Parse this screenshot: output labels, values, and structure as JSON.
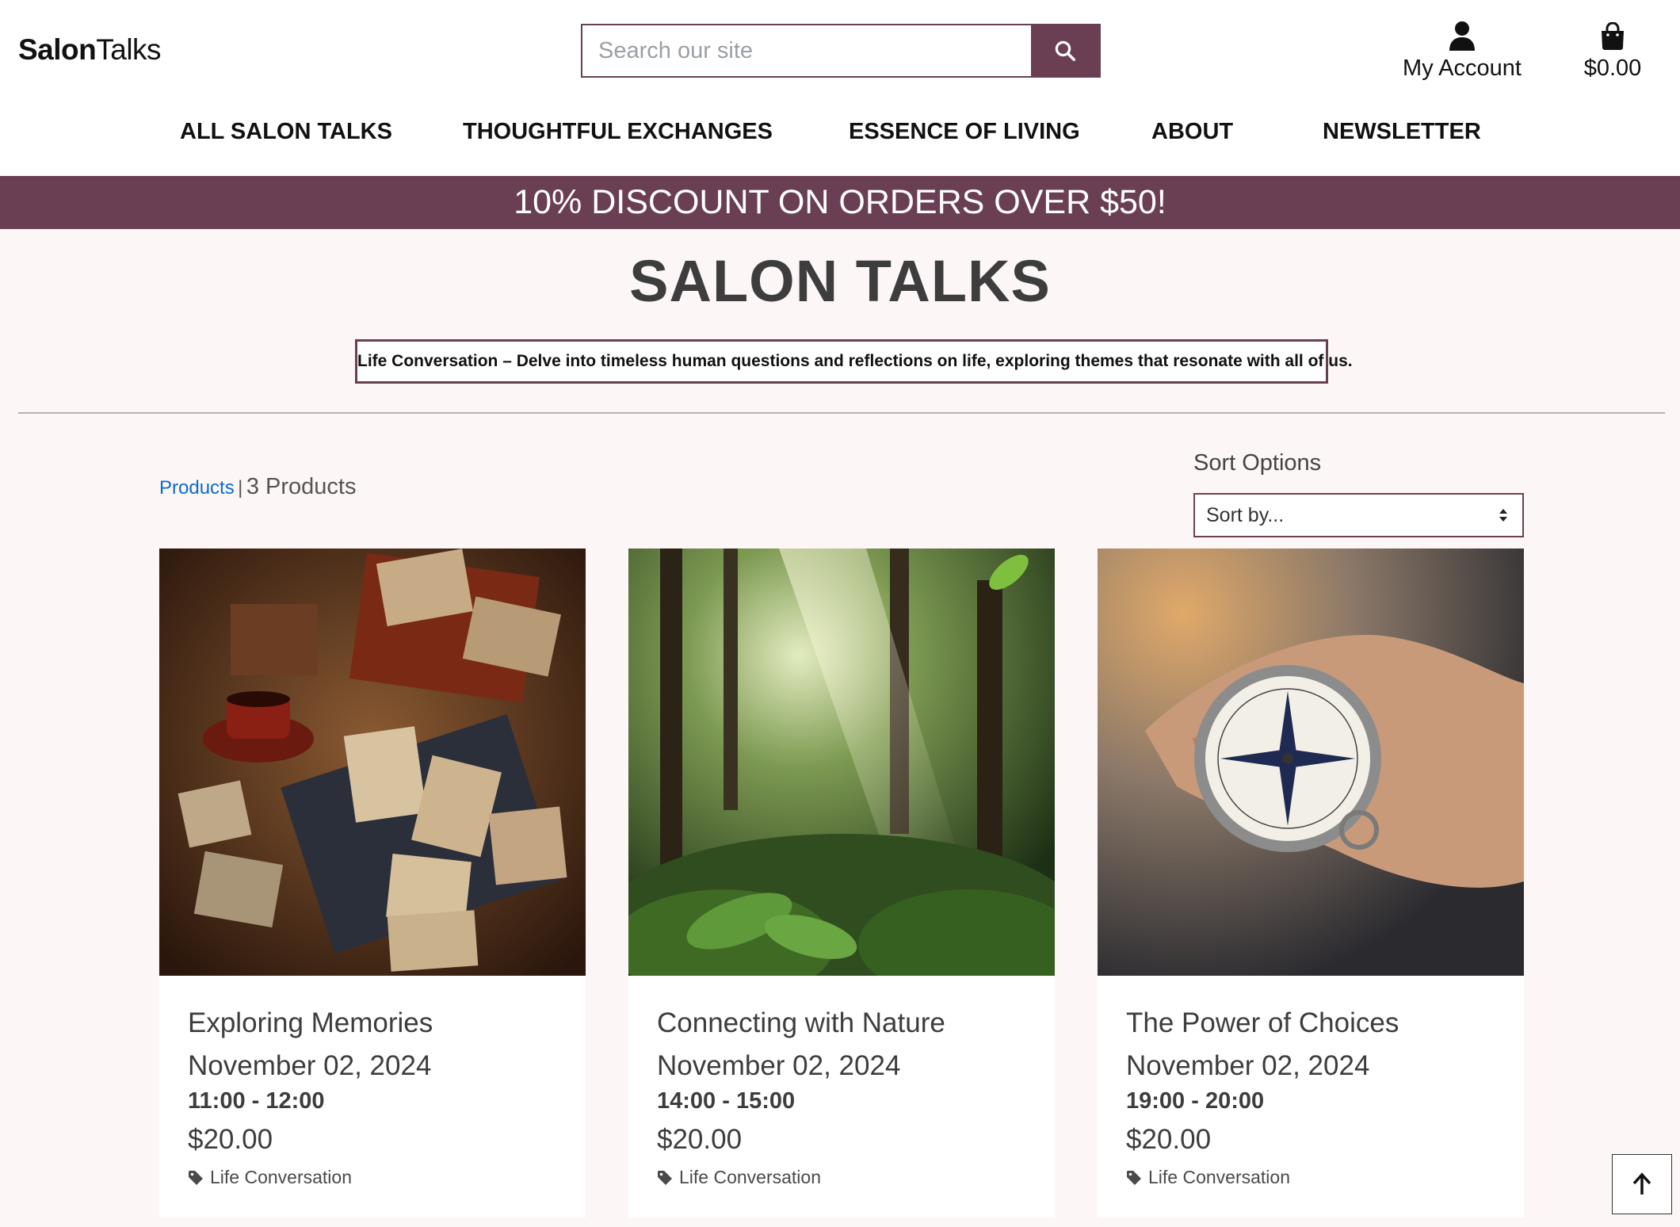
{
  "header": {
    "logo_bold": "Salon",
    "logo_regular": "Talks",
    "search_placeholder": "Search our site",
    "account_label": "My Account",
    "bag_total": "$0.00"
  },
  "nav": {
    "items": [
      {
        "label": "ALL SALON TALKS"
      },
      {
        "label": "THOUGHTFUL EXCHANGES"
      },
      {
        "label": "ESSENCE OF LIVING"
      },
      {
        "label": "ABOUT"
      },
      {
        "label": "NEWSLETTER"
      }
    ]
  },
  "promo": "10% DISCOUNT ON ORDERS OVER $50!",
  "page": {
    "title": "SALON TALKS",
    "category_description": "Life Conversation – Delve into timeless human questions and reflections on life, exploring themes that resonate with all of us.",
    "products_link": "Products",
    "separator": "|",
    "product_count": "3 Products",
    "sort_label": "Sort Options",
    "sort_value": "Sort by..."
  },
  "products": [
    {
      "name": "Exploring Memories",
      "date": "November 02, 2024",
      "time": "11:00 - 12:00",
      "price": "$20.00",
      "tag": "Life Conversation",
      "image": "vintage-photos-and-tea"
    },
    {
      "name": "Connecting with Nature",
      "date": "November 02, 2024",
      "time": "14:00 - 15:00",
      "price": "$20.00",
      "tag": "Life Conversation",
      "image": "sunlit-forest"
    },
    {
      "name": "The Power of Choices",
      "date": "November 02, 2024",
      "time": "19:00 - 20:00",
      "price": "$20.00",
      "tag": "Life Conversation",
      "image": "hand-holding-compass"
    }
  ],
  "colors": {
    "brand": "#6b3f53",
    "page_bg": "#fcf6f6",
    "link": "#0b6bd3"
  },
  "icons": {
    "search": "search-icon",
    "account": "user-icon",
    "bag": "shopping-bag-icon",
    "tag": "tag-icon",
    "back_to_top": "arrow-up-icon"
  }
}
